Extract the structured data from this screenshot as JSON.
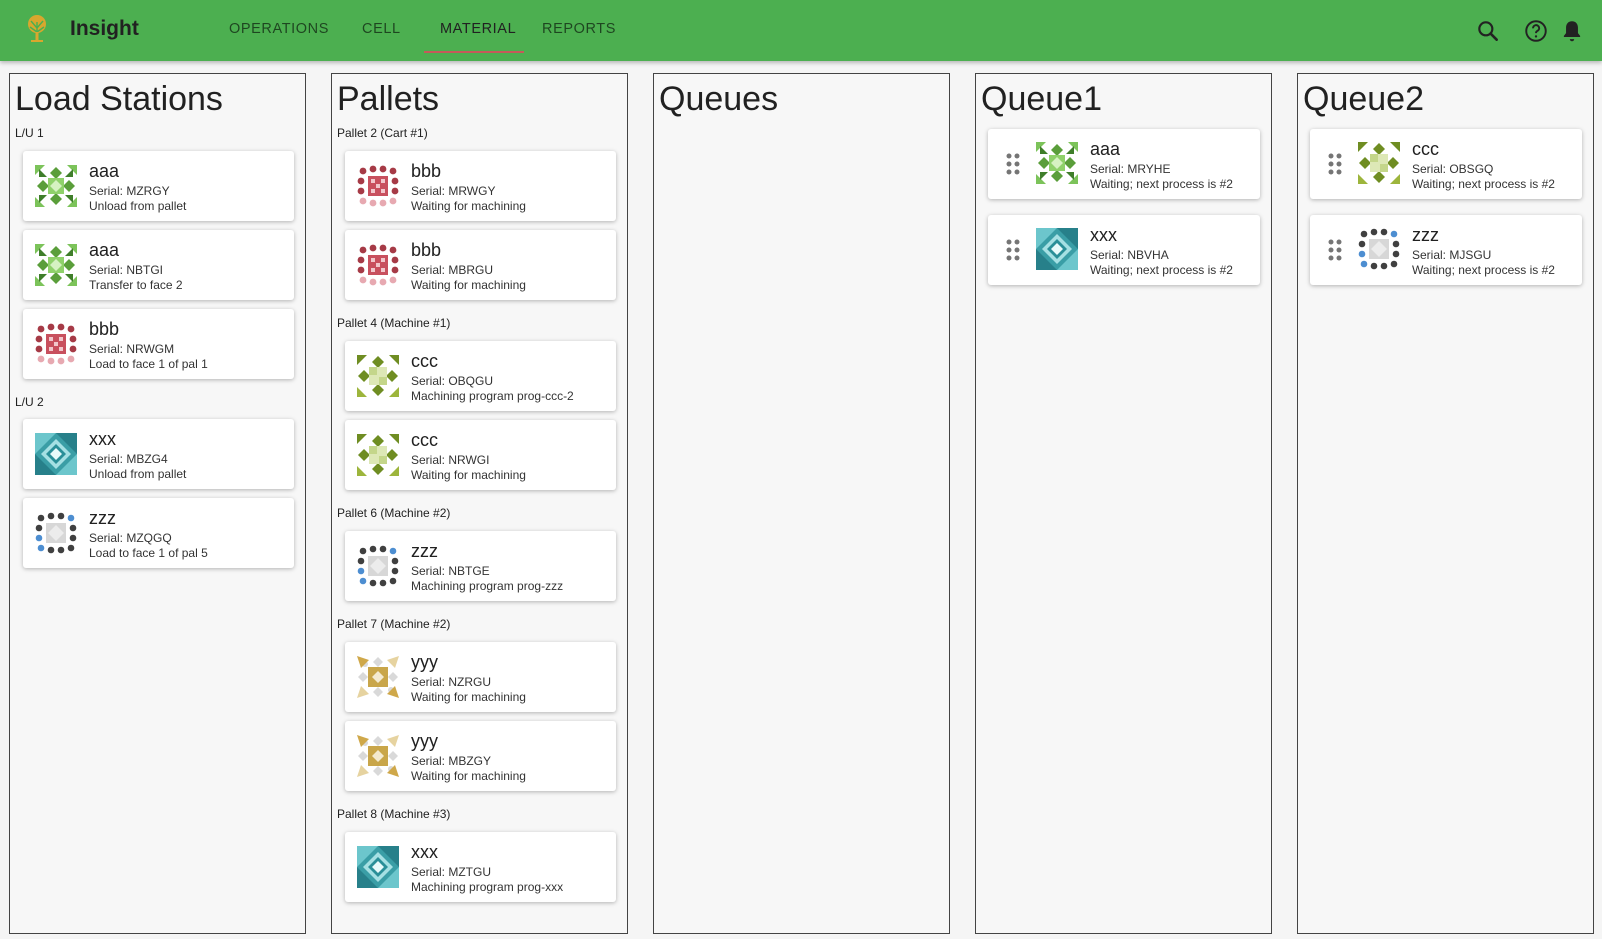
{
  "app": {
    "brand": "Insight"
  },
  "tabs": [
    {
      "label": "OPERATIONS",
      "active": false
    },
    {
      "label": "CELL",
      "active": false
    },
    {
      "label": "MATERIAL",
      "active": true
    },
    {
      "label": "REPORTS",
      "active": false
    }
  ],
  "toolbar_icons": [
    "search-icon",
    "help-icon",
    "notifications-icon"
  ],
  "colors": {
    "appbar": "#4caf50",
    "tab_indicator": "#c65a5a"
  },
  "columns": {
    "load_stations": {
      "title": "Load Stations",
      "groups": [
        {
          "label": "L/U 1",
          "cards": [
            {
              "name": "aaa",
              "serial": "Serial: MZRGY",
              "action": "Unload from pallet",
              "icon": "part-aaa-icon"
            },
            {
              "name": "aaa",
              "serial": "Serial: NBTGI",
              "action": "Transfer to face 2",
              "icon": "part-aaa-icon"
            },
            {
              "name": "bbb",
              "serial": "Serial: NRWGM",
              "action": "Load to face 1 of pal 1",
              "icon": "part-bbb-icon"
            }
          ]
        },
        {
          "label": "L/U 2",
          "cards": [
            {
              "name": "xxx",
              "serial": "Serial: MBZG4",
              "action": "Unload from pallet",
              "icon": "part-xxx-icon"
            },
            {
              "name": "zzz",
              "serial": "Serial: MZQGQ",
              "action": "Load to face 1 of pal 5",
              "icon": "part-zzz-icon"
            }
          ]
        }
      ]
    },
    "pallets": {
      "title": "Pallets",
      "groups": [
        {
          "label": "Pallet 2 (Cart #1)",
          "cards": [
            {
              "name": "bbb",
              "serial": "Serial: MRWGY",
              "action": "Waiting for machining",
              "icon": "part-bbb-icon"
            },
            {
              "name": "bbb",
              "serial": "Serial: MBRGU",
              "action": "Waiting for machining",
              "icon": "part-bbb-icon"
            }
          ]
        },
        {
          "label": "Pallet 4 (Machine #1)",
          "cards": [
            {
              "name": "ccc",
              "serial": "Serial: OBQGU",
              "action": "Machining program prog-ccc-2",
              "icon": "part-ccc-icon"
            },
            {
              "name": "ccc",
              "serial": "Serial: NRWGI",
              "action": "Waiting for machining",
              "icon": "part-ccc-icon"
            }
          ]
        },
        {
          "label": "Pallet 6 (Machine #2)",
          "cards": [
            {
              "name": "zzz",
              "serial": "Serial: NBTGE",
              "action": "Machining program prog-zzz",
              "icon": "part-zzz-icon"
            }
          ]
        },
        {
          "label": "Pallet 7 (Machine #2)",
          "cards": [
            {
              "name": "yyy",
              "serial": "Serial: NZRGU",
              "action": "Waiting for machining",
              "icon": "part-yyy-icon"
            },
            {
              "name": "yyy",
              "serial": "Serial: MBZGY",
              "action": "Waiting for machining",
              "icon": "part-yyy-icon"
            }
          ]
        },
        {
          "label": "Pallet 8 (Machine #3)",
          "cards": [
            {
              "name": "xxx",
              "serial": "Serial: MZTGU",
              "action": "Machining program prog-xxx",
              "icon": "part-xxx-icon"
            }
          ]
        }
      ]
    },
    "queues": {
      "title": "Queues"
    },
    "queue1": {
      "title": "Queue1",
      "cards": [
        {
          "name": "aaa",
          "serial": "Serial: MRYHE",
          "action": "Waiting; next process is #2",
          "icon": "part-aaa-icon"
        },
        {
          "name": "xxx",
          "serial": "Serial: NBVHA",
          "action": "Waiting; next process is #2",
          "icon": "part-xxx-icon"
        }
      ]
    },
    "queue2": {
      "title": "Queue2",
      "cards": [
        {
          "name": "ccc",
          "serial": "Serial: OBSGQ",
          "action": "Waiting; next process is #2",
          "icon": "part-ccc-icon"
        },
        {
          "name": "zzz",
          "serial": "Serial: MJSGU",
          "action": "Waiting; next process is #2",
          "icon": "part-zzz-icon"
        }
      ]
    }
  }
}
